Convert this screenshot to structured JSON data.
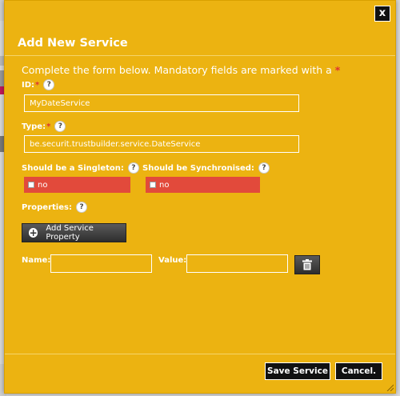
{
  "dialog": {
    "title": "Add New Service",
    "close_label": "x",
    "intro_text": "Complete the form below. Mandatory fields are marked with a ",
    "required_marker": "*"
  },
  "fields": {
    "id": {
      "label": "ID:",
      "value": "MyDateService"
    },
    "type": {
      "label": "Type:",
      "value": "be.securit.trustbuilder.service.DateService"
    },
    "singleton": {
      "label": "Should be a Singleton:",
      "value": "no"
    },
    "synchronised": {
      "label": "Should be Synchronised:",
      "value": "no"
    },
    "properties": {
      "label": "Properties:"
    },
    "name": {
      "label": "Name:",
      "value": ""
    },
    "value": {
      "label": "Value:",
      "value": ""
    }
  },
  "help_glyph": "?",
  "buttons": {
    "add_property": "Add Service Property",
    "add_icon": "+",
    "save": "Save Service",
    "cancel": "Cancel."
  },
  "colors": {
    "dialog_bg": "#ecb311",
    "required": "#dd3333",
    "toggle_bg": "#e24a3b",
    "button_dark": "#111111"
  },
  "icons": [
    "close-icon",
    "help-icon",
    "plus-icon",
    "trash-icon",
    "checkbox-icon",
    "resize-grip-icon"
  ]
}
